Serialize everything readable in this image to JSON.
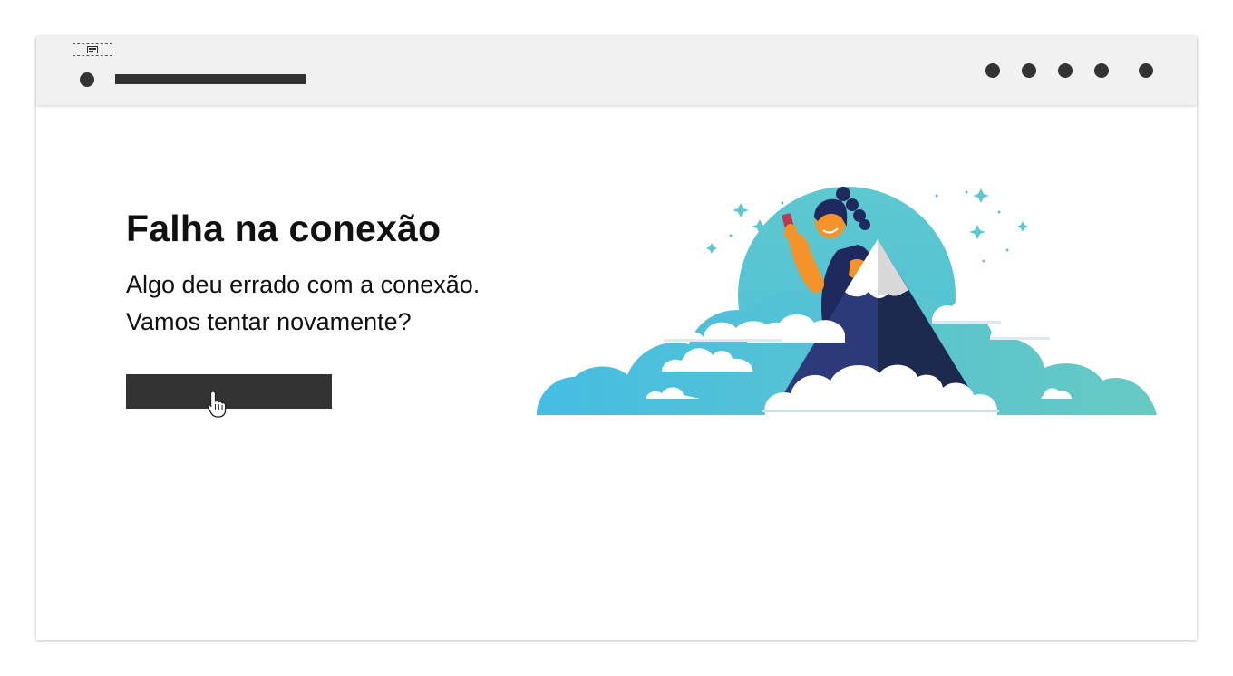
{
  "error": {
    "title": "Falha na conexão",
    "message_line1": "Algo deu errado com a conexão.",
    "message_line2": "Vamos tentar novamente?"
  },
  "icons": {
    "placeholder": "image-placeholder-icon",
    "logo": "logo-dot",
    "cursor": "hand-pointer-cursor-icon"
  },
  "colors": {
    "topbar_bg": "#f2f1f2",
    "placeholder_dark": "#333333",
    "sky_teal": "#5cc7cf",
    "sky_blue": "#47bde0",
    "mountain": "#2c3a78",
    "skin": "#f5932b"
  }
}
